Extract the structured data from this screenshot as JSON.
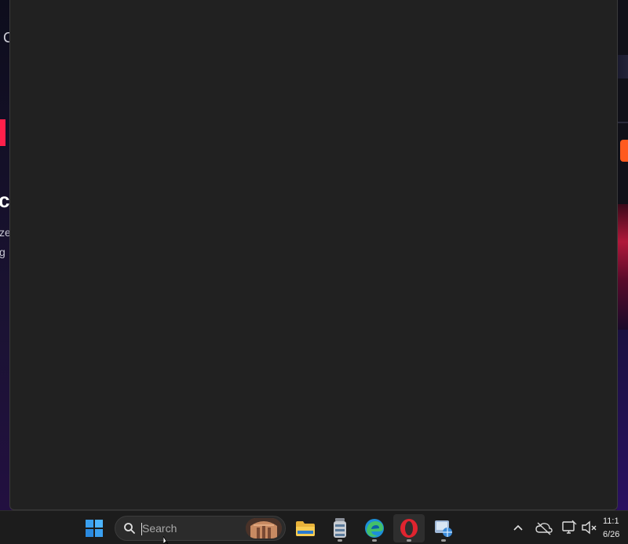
{
  "background_page": {
    "top_fragment": "C",
    "heading_fragment": "c",
    "line1_fragment": "ze",
    "line2_fragment": "g"
  },
  "taskbar": {
    "search": {
      "placeholder": "Search",
      "icon": "search-icon"
    },
    "apps": [
      {
        "name": "File Explorer",
        "icon": "folder-icon"
      },
      {
        "name": "App",
        "icon": "jar-icon"
      },
      {
        "name": "Microsoft Edge",
        "icon": "edge-icon"
      },
      {
        "name": "Opera",
        "icon": "opera-icon"
      },
      {
        "name": "App",
        "icon": "network-globe-icon"
      }
    ],
    "tray": {
      "chevron": "chevron-up-icon",
      "cloud": "cloud-off-icon",
      "display": "display-icon",
      "volume": "volume-muted-icon"
    },
    "clock": {
      "time": "11:1",
      "date": "6/26"
    }
  },
  "colors": {
    "panel": "#212121",
    "taskbar": "#1c1c1c",
    "accent_red": "#ff1f4b",
    "accent_orange": "#ff5a1f",
    "opera_red": "#e0242f"
  }
}
